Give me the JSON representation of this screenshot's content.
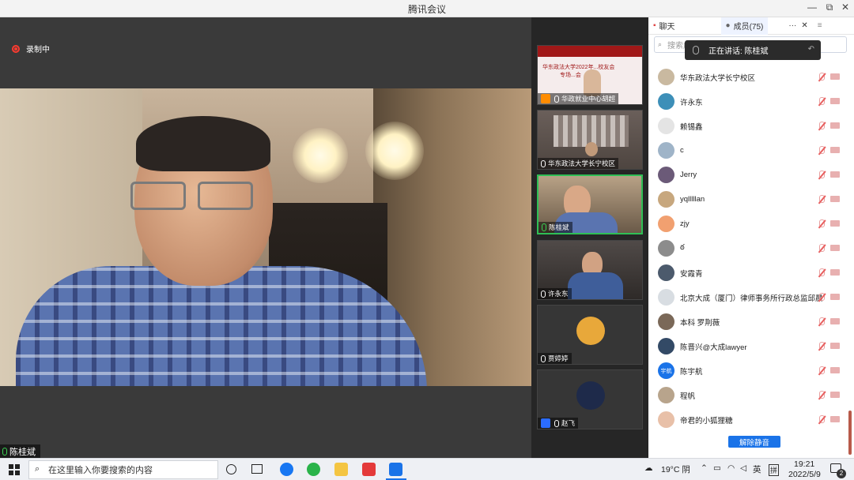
{
  "window": {
    "title": "腾讯会议",
    "minimize": "—",
    "restore": "⧉",
    "close": "✕"
  },
  "recording": {
    "label": "录制中"
  },
  "main": {
    "speaker_name": "陈桂斌"
  },
  "strip": {
    "tiles": [
      {
        "name": "华政就业中心胡超",
        "banner_line1": "华东政法大学2022年...校友会",
        "banner_line2": "专场...会"
      },
      {
        "name": "华东政法大学长宁校区"
      },
      {
        "name": "陈桂斌"
      },
      {
        "name": "许永东"
      },
      {
        "name": "贾婷婷"
      },
      {
        "name": "赵飞"
      }
    ]
  },
  "sidebar": {
    "tab_chat": "聊天",
    "tab_members": "成员(75)",
    "more": "···",
    "close": "✕",
    "menu": "≡",
    "search_placeholder": "搜索成",
    "speaking_now": "正在讲话: 陈桂斌",
    "members": [
      {
        "name": "华东政法大学长宁校区",
        "avatar_color": "#c9b9a0"
      },
      {
        "name": "许永东",
        "avatar_color": "#3d8fb8"
      },
      {
        "name": "赖锡鑫",
        "avatar_color": "#e4e4e4"
      },
      {
        "name": "c",
        "avatar_color": "#9fb4c8"
      },
      {
        "name": "Jerry",
        "avatar_color": "#6b5a78"
      },
      {
        "name": "yqlllllan",
        "avatar_color": "#c7a77e"
      },
      {
        "name": "zjy",
        "avatar_color": "#f1a070"
      },
      {
        "name": "ఠ",
        "avatar_color": "#8c8c8c"
      },
      {
        "name": "安霞青",
        "avatar_color": "#4c5a6c"
      },
      {
        "name": "北京大成（厦门）律师事务所行政总监邱晨",
        "avatar_color": "#d8dde2"
      },
      {
        "name": "本科 罗荆薇",
        "avatar_color": "#7a6858"
      },
      {
        "name": "陈晋兴@大成lawyer",
        "avatar_color": "#334a66"
      },
      {
        "name": "陈宇航",
        "avatar_color": "#1a73e8",
        "avatar_text": "宇航"
      },
      {
        "name": "程帆",
        "avatar_color": "#b8a48c"
      },
      {
        "name": "帝君的小狐狸糖",
        "avatar_color": "#e8c0a8"
      }
    ],
    "unmute_all": "解除静音"
  },
  "taskbar": {
    "search_placeholder": "在这里输入你要搜索的内容",
    "weather": "19°C 阴",
    "ime": "英",
    "ime2": "拼",
    "time": "19:21",
    "date": "2022/5/9",
    "notif_count": "2"
  }
}
